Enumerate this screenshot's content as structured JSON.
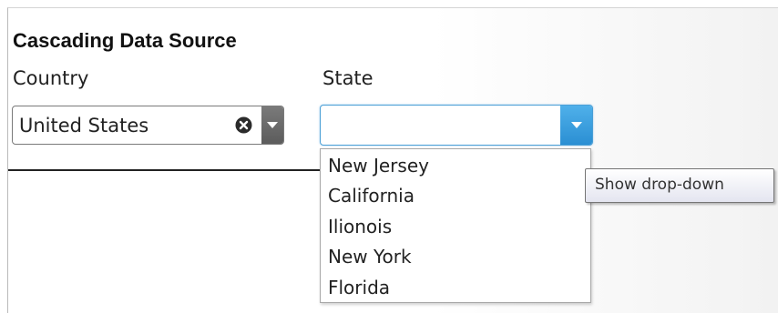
{
  "section": {
    "title": "Cascading Data Source"
  },
  "country": {
    "label": "Country",
    "value": "United States",
    "clear_icon": "clear-circle-x-icon",
    "arrow_icon": "chevron-down-icon"
  },
  "state": {
    "label": "State",
    "value": "",
    "arrow_icon": "chevron-down-icon",
    "accent_color": "#3a9de0"
  },
  "dropdown": {
    "items": [
      {
        "label": "New Jersey"
      },
      {
        "label": "California"
      },
      {
        "label": "Ilionois"
      },
      {
        "label": "New York"
      },
      {
        "label": "Florida"
      }
    ]
  },
  "tooltip": {
    "text": "Show drop-down"
  }
}
